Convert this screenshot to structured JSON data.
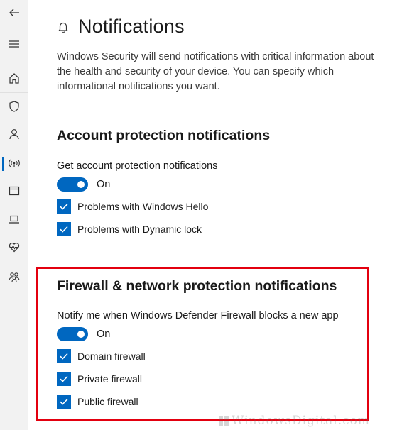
{
  "header": {
    "title": "Notifications",
    "description": "Windows Security will send notifications with critical information about the health and security of your device. You can specify which informational notifications you want."
  },
  "account": {
    "title": "Account protection notifications",
    "setting_label": "Get account protection notifications",
    "toggle_state": "On",
    "checkboxes": [
      {
        "label": "Problems with Windows Hello",
        "checked": true
      },
      {
        "label": "Problems with Dynamic lock",
        "checked": true
      }
    ]
  },
  "firewall": {
    "title": "Firewall & network protection notifications",
    "setting_label": "Notify me when Windows Defender Firewall blocks a new app",
    "toggle_state": "On",
    "checkboxes": [
      {
        "label": "Domain firewall",
        "checked": true
      },
      {
        "label": "Private firewall",
        "checked": true
      },
      {
        "label": "Public firewall",
        "checked": true
      }
    ]
  },
  "sidebar": {
    "icons": [
      "back-arrow-icon",
      "hamburger-menu-icon",
      "home-icon",
      "shield-icon",
      "person-icon",
      "wireless-antenna-icon",
      "browser-window-icon",
      "laptop-icon",
      "heart-pulse-icon",
      "family-icon"
    ],
    "active": "wireless-antenna-icon"
  },
  "watermark": {
    "text": "WindowsDigital.com"
  },
  "colors": {
    "accent": "#0067c0",
    "highlight": "#e3000f",
    "rail_bg": "#f2f2f2"
  }
}
